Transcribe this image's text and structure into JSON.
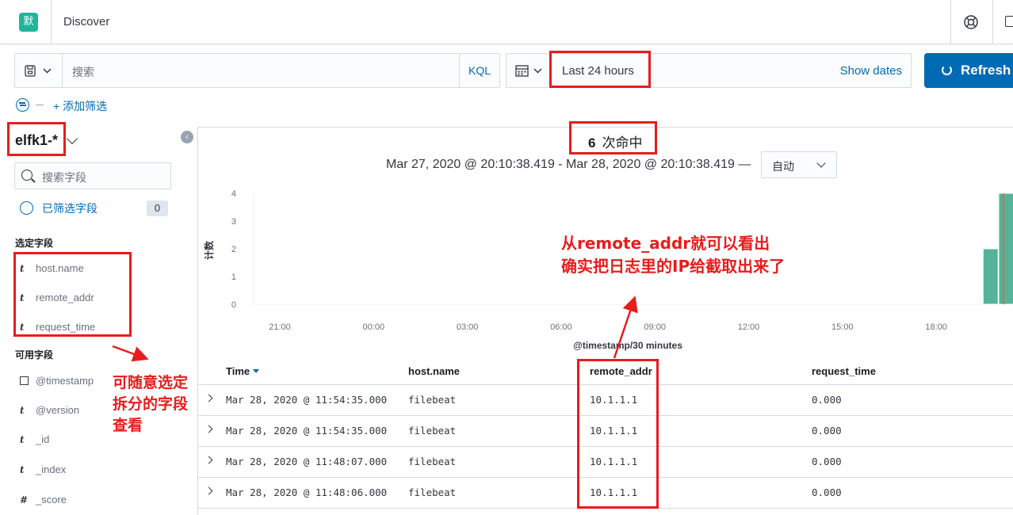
{
  "header": {
    "logo_glyph": "默",
    "breadcrumb": "Discover",
    "help_icon": "lifebuoy-icon",
    "mail_icon": "mail-icon"
  },
  "query_bar": {
    "placeholder": "搜索",
    "language": "KQL"
  },
  "date_picker": {
    "range": "Last 24 hours",
    "show_dates": "Show dates"
  },
  "refresh_label": "Refresh",
  "filters": {
    "add_label": "+ 添加筛选"
  },
  "sidebar": {
    "index_pattern": "elfk1-*",
    "search_placeholder": "搜索字段",
    "filtered_fields_label": "已筛选字段",
    "filtered_fields_count": "0",
    "selected_title": "选定字段",
    "selected_fields": [
      {
        "type": "t",
        "name": "host.name"
      },
      {
        "type": "t",
        "name": "remote_addr"
      },
      {
        "type": "t",
        "name": "request_time"
      }
    ],
    "available_title": "可用字段",
    "available_fields": [
      {
        "type": "date",
        "name": "@timestamp"
      },
      {
        "type": "t",
        "name": "@version"
      },
      {
        "type": "t",
        "name": "_id"
      },
      {
        "type": "t",
        "name": "_index"
      },
      {
        "type": "#",
        "name": "_score"
      }
    ]
  },
  "results": {
    "hits": "6",
    "hits_label": "次命中",
    "range_text": "Mar 27, 2020 @ 20:10:38.419 - Mar 28, 2020 @ 20:10:38.419 —",
    "interval": "自动"
  },
  "chart_data": {
    "type": "bar",
    "x_categories": [
      "21:00",
      "00:00",
      "03:00",
      "06:00",
      "09:00",
      "12:00",
      "15:00",
      "18:00"
    ],
    "ylabel": "计数",
    "xlabel": "@timestamp/30 minutes",
    "ylim": [
      0,
      4
    ],
    "yticks": [
      "0",
      "1",
      "2",
      "3",
      "4"
    ],
    "bars": [
      {
        "x": "19:30",
        "value": 2
      },
      {
        "x": "20:00",
        "value": 4
      }
    ],
    "bar_color": "#54b399",
    "now_marker_color": "#e7664c"
  },
  "table": {
    "columns": [
      "Time",
      "host.name",
      "remote_addr",
      "request_time"
    ],
    "rows": [
      [
        "Mar 28, 2020 @ 11:54:35.000",
        "filebeat",
        "10.1.1.1",
        "0.000"
      ],
      [
        "Mar 28, 2020 @ 11:54:35.000",
        "filebeat",
        "10.1.1.1",
        "0.000"
      ],
      [
        "Mar 28, 2020 @ 11:48:07.000",
        "filebeat",
        "10.1.1.1",
        "0.000"
      ],
      [
        "Mar 28, 2020 @ 11:48:06.000",
        "filebeat",
        "10.1.1.1",
        "0.000"
      ]
    ]
  },
  "annotations": {
    "left_note": [
      "可随意选定",
      "拆分的字段",
      "查看"
    ],
    "chart_note": [
      "从remote_addr就可以看出",
      "确实把日志里的IP给截取出来了"
    ],
    "color": "#e81c1c"
  }
}
